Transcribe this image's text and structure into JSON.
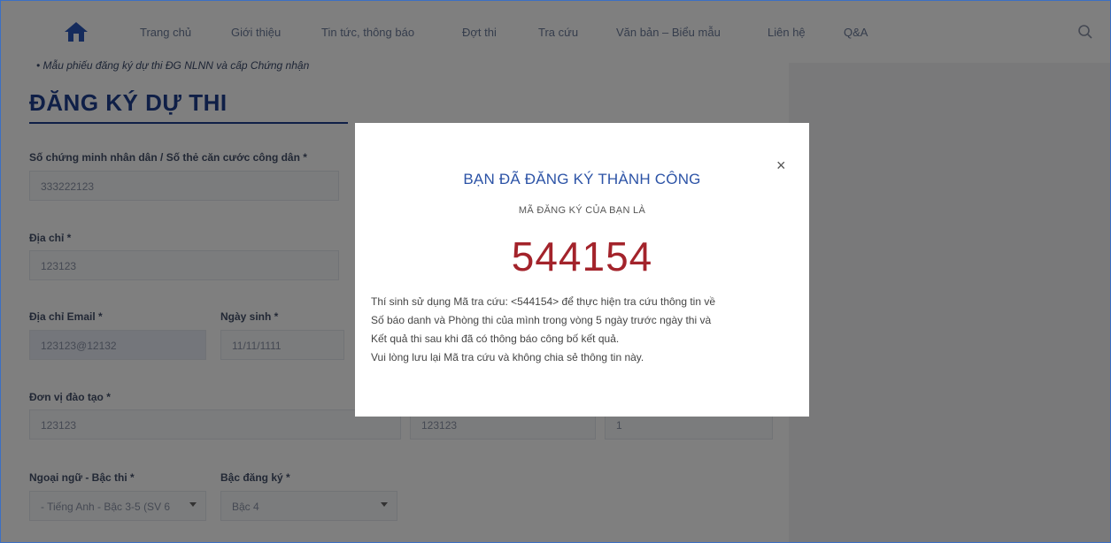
{
  "nav": {
    "items": [
      "Trang chủ",
      "Giới thiệu",
      "Tin tức, thông báo",
      "Đợt thi",
      "Tra cứu",
      "Văn bản – Biểu mẫu",
      "Liên hệ",
      "Q&A"
    ]
  },
  "page": {
    "note": "• Mẫu phiếu đăng ký dự thi ĐG NLNN và cấp Chứng nhận",
    "title": "ĐĂNG KÝ DỰ THI"
  },
  "form": {
    "id_label": "Số chứng minh nhân dân / Số thẻ căn cước công dân *",
    "id_value": "333222123",
    "address_label": "Địa chỉ *",
    "address_value": "123123",
    "email_label": "Địa chỉ Email *",
    "email_value": "123123@12132",
    "dob_label": "Ngày sinh *",
    "dob_value": "11/11/1111",
    "unit_label": "Đơn vị đào tạo *",
    "unit_value": "123123",
    "unit_value2": "123123",
    "unit_value3": "1",
    "language_label": "Ngoại ngữ - Bậc thi *",
    "language_value": "- Tiếng Anh - Bậc 3-5 (SV 6",
    "level_label": "Bậc đăng ký *",
    "level_value": "Bậc 4"
  },
  "modal": {
    "title": "BẠN ĐÃ ĐĂNG KÝ THÀNH CÔNG",
    "subtitle": "MÃ ĐĂNG KÝ CỦA BẠN LÀ",
    "code": "544154",
    "line1": "Thí sinh sử dụng Mã tra cứu: <544154> để thực hiện tra cứu thông tin về",
    "line2": "Số báo danh và Phòng thi của mình trong vòng 5 ngày trước ngày thi và",
    "line3": "Kết quả thi sau khi đã có thông báo công bố kết quả.",
    "line4": "Vui lòng lưu lại Mã tra cứu và không chia sẻ thông tin này.",
    "close_symbol": "×"
  },
  "colors": {
    "brand": "#1f3f8f",
    "modal_title": "#2c53a6",
    "code": "#a3232b"
  }
}
